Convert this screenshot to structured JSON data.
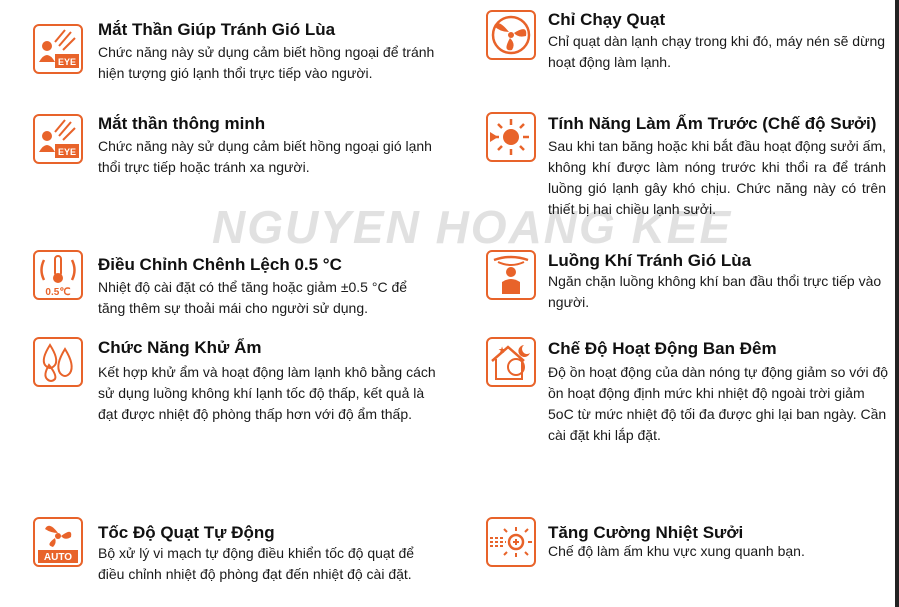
{
  "watermark": "NGUYEN HOANG KEE",
  "features": [
    {
      "id": "mat-than-giup-tranh-gio-lua",
      "icon": "eye-sensor-icon",
      "icon_text": "EYE",
      "title": "Mắt Thần Giúp Tránh Gió Lùa",
      "desc": "Chức năng này sử dụng cảm biết hồng ngoại để tránh hiện tượng gió lạnh thổi trực tiếp vào người."
    },
    {
      "id": "mat-than-thong-minh",
      "icon": "eye-sensor-icon",
      "icon_text": "EYE",
      "title": "Mắt thần thông minh",
      "desc": "Chức năng này sử dụng cảm biết hồng ngoại gió lạnh thổi trực tiếp hoặc tránh xa người."
    },
    {
      "id": "dieu-chinh-chenh-lech",
      "icon": "thermometer-icon",
      "icon_text": "0.5℃",
      "title": "Điều Chỉnh Chênh Lệch 0.5 °C",
      "desc": "Nhiệt độ cài đặt có thể tăng hoặc giảm ±0.5 °C để tăng thêm sự thoải mái cho người sử dụng."
    },
    {
      "id": "chuc-nang-khu-am",
      "icon": "water-drops-icon",
      "title": "Chức Năng Khử Ẩm",
      "desc": "Kết hợp khử ẩm và hoạt động làm lạnh khô bằng cách sử dụng luồng không khí lạnh tốc độ thấp, kết quả là đạt được nhiệt độ phòng thấp hơn với độ ẩm thấp."
    },
    {
      "id": "toc-do-quat-tu-dong",
      "icon": "fan-auto-icon",
      "icon_text": "AUTO",
      "title": "Tốc Độ Quạt Tự Động",
      "desc": "Bộ xử lý vi mạch tự động điều khiển tốc độ quạt để điều chỉnh nhiệt độ phòng đạt đến nhiệt độ cài đặt."
    },
    {
      "id": "chi-chay-quat",
      "icon": "fan-icon",
      "title": "Chỉ Chạy Quạt",
      "desc": "Chỉ quạt dàn lạnh chạy trong khi đó, máy nén sẽ dừng hoạt động làm lạnh."
    },
    {
      "id": "tinh-nang-lam-am-truoc",
      "icon": "sun-arrow-icon",
      "title": "Tính Năng Làm Ấm Trước (Chế độ Sưởi)",
      "desc": "Sau khi tan băng hoặc khi bắt đầu hoạt động sưởi ấm, không khí được làm nóng trước khi thổi ra để tránh luồng gió lạnh gây khó chịu. Chức năng này có trên thiết bị hai chiều lạnh sưởi."
    },
    {
      "id": "luong-khi-tranh-gio-lua",
      "icon": "person-airflow-icon",
      "title": "Luồng Khí Tránh Gió Lùa",
      "desc": "Ngăn chặn luồng không khí ban đầu thổi trực tiếp vào người."
    },
    {
      "id": "che-do-hoat-dong-ban-dem",
      "icon": "night-house-icon",
      "title": "Chế Độ Hoạt Động Ban Đêm",
      "desc": "Độ ồn hoạt động của dàn nóng tự động giảm so với độ ồn hoạt động định mức khi nhiệt độ ngoài trời giảm 5oC từ mức nhiệt độ tối đa được ghi lại ban ngày. Cần cài đặt khi lắp đặt."
    },
    {
      "id": "tang-cuong-nhiet-suoi",
      "icon": "heating-boost-icon",
      "title": "Tăng Cường Nhiệt Sưởi",
      "desc": "Chế độ làm ấm khu vực xung quanh bạn."
    }
  ],
  "colors": {
    "accent": "#e8632a"
  }
}
